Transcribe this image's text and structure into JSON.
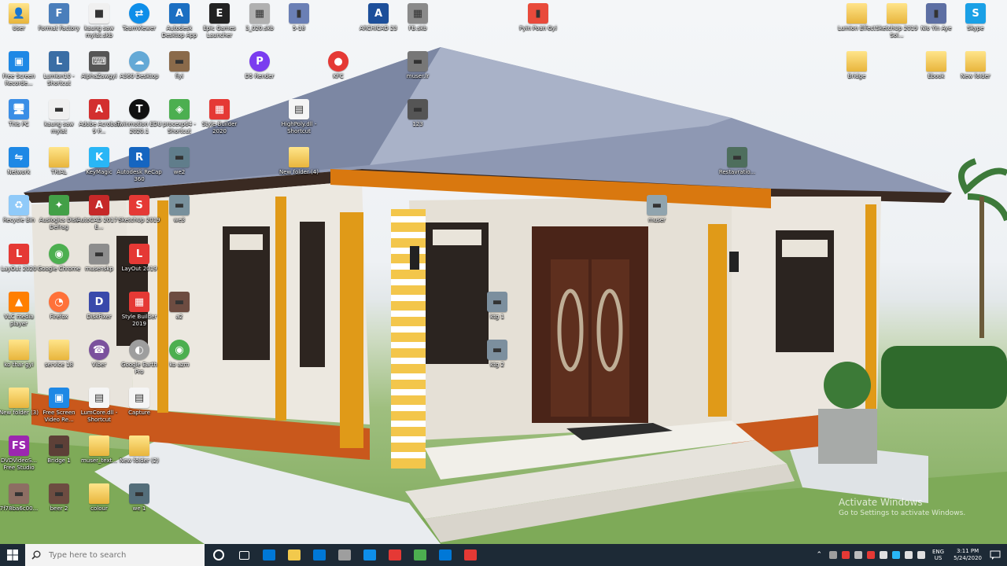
{
  "desktop": {
    "icons": [
      {
        "label": "User",
        "color": "#f2c94c",
        "kind": "folder",
        "glyph": "👤"
      },
      {
        "label": "Format Factory",
        "color": "#4a7ebb",
        "kind": "app",
        "glyph": "F"
      },
      {
        "label": "kaung saw mylat.skb",
        "color": "#f0f0f0",
        "kind": "file",
        "glyph": "■"
      },
      {
        "label": "TeamViewer",
        "color": "#0e8ee9",
        "kind": "round",
        "glyph": "⇄"
      },
      {
        "label": "Autodesk Desktop App",
        "color": "#1b6fc2",
        "kind": "app",
        "glyph": "A"
      },
      {
        "label": "Epic Games Launcher",
        "color": "#222222",
        "kind": "app",
        "glyph": "E"
      },
      {
        "label": "3_020.skb",
        "color": "#b0b0b0",
        "kind": "file",
        "glyph": "▦"
      },
      {
        "label": "5-18",
        "color": "#6a7fb5",
        "kind": "file",
        "glyph": "▮"
      },
      {
        "label": "ARCHICAD 23",
        "color": "#1d4f9a",
        "kind": "app",
        "glyph": "A"
      },
      {
        "label": "FB.skb",
        "color": "#8a8a8a",
        "kind": "file",
        "glyph": "▦"
      },
      {
        "label": "Pyin Poan Gyi",
        "color": "#e84a3b",
        "kind": "file",
        "glyph": "▮"
      },
      {
        "label": "Lumion Effect",
        "color": "#f2c94c",
        "kind": "folder",
        "glyph": ""
      },
      {
        "label": "SketchUp 2019 Sol...",
        "color": "#f2c94c",
        "kind": "folder",
        "glyph": ""
      },
      {
        "label": "Nio Yin Aye",
        "color": "#5d6fa3",
        "kind": "file",
        "glyph": "▮"
      },
      {
        "label": "Skype",
        "color": "#1aa0e6",
        "kind": "app",
        "glyph": "S"
      },
      {
        "label": "Free Screen Recorde...",
        "color": "#1e88e5",
        "kind": "app",
        "glyph": "▣"
      },
      {
        "label": "Lumion10 - Shortcut",
        "color": "#3a6ea5",
        "kind": "app",
        "glyph": "L"
      },
      {
        "label": "AlphaZawgyi",
        "color": "#555555",
        "kind": "app",
        "glyph": "⌨"
      },
      {
        "label": "A360 Desktop",
        "color": "#64a9d6",
        "kind": "round",
        "glyph": "☁"
      },
      {
        "label": "fiyi",
        "color": "#8a6a4a",
        "kind": "file",
        "glyph": "▬"
      },
      {
        "label": "D5 Render",
        "color": "#7a3cf0",
        "kind": "round",
        "glyph": "P"
      },
      {
        "label": "KFC",
        "color": "#e53935",
        "kind": "round",
        "glyph": "●"
      },
      {
        "label": "muser.lr",
        "color": "#777777",
        "kind": "file",
        "glyph": "▬"
      },
      {
        "label": "Bridge",
        "color": "#f2c94c",
        "kind": "folder",
        "glyph": ""
      },
      {
        "label": "Ebook",
        "color": "#f2c94c",
        "kind": "folder",
        "glyph": ""
      },
      {
        "label": "New folder",
        "color": "#f2c94c",
        "kind": "folder",
        "glyph": ""
      },
      {
        "label": "This PC",
        "color": "#3a8ee6",
        "kind": "app",
        "glyph": "🖥"
      },
      {
        "label": "kaung saw mylat",
        "color": "#f0f0f0",
        "kind": "file",
        "glyph": "▬"
      },
      {
        "label": "Adobe Acrobat 9 P...",
        "color": "#d32f2f",
        "kind": "app",
        "glyph": "A"
      },
      {
        "label": "Twinmotion EDU 2020.1",
        "color": "#111111",
        "kind": "round",
        "glyph": "T"
      },
      {
        "label": "procexp64 - Shortcut",
        "color": "#4caf50",
        "kind": "app",
        "glyph": "◈"
      },
      {
        "label": "Style Builder 2020",
        "color": "#e53935",
        "kind": "app",
        "glyph": "▦"
      },
      {
        "label": "HighPoly.dll - Shortcut",
        "color": "#f5f5f5",
        "kind": "file",
        "glyph": "▤"
      },
      {
        "label": "123",
        "color": "#555555",
        "kind": "file",
        "glyph": "▬"
      },
      {
        "label": "Network",
        "color": "#1e88e5",
        "kind": "app",
        "glyph": "⇋"
      },
      {
        "label": "TRIAL",
        "color": "#f2c94c",
        "kind": "folder",
        "glyph": ""
      },
      {
        "label": "KeyMagic",
        "color": "#29b6f6",
        "kind": "app",
        "glyph": "K"
      },
      {
        "label": "Autodesk ReCap 360",
        "color": "#1565c0",
        "kind": "app",
        "glyph": "R"
      },
      {
        "label": "we2",
        "color": "#607d8b",
        "kind": "file",
        "glyph": "▬"
      },
      {
        "label": "New folder (4)",
        "color": "#f2c94c",
        "kind": "folder",
        "glyph": ""
      },
      {
        "label": "Restavratio...",
        "color": "#4e6e5d",
        "kind": "file",
        "glyph": "▬"
      },
      {
        "label": "Recycle Bin",
        "color": "#90caf9",
        "kind": "app",
        "glyph": "♻"
      },
      {
        "label": "Auslogics Disk Defrag",
        "color": "#43a047",
        "kind": "app",
        "glyph": "✦"
      },
      {
        "label": "AutoCAD 2017 - E...",
        "color": "#c62828",
        "kind": "app",
        "glyph": "A"
      },
      {
        "label": "SketchUp 2019",
        "color": "#e53935",
        "kind": "app",
        "glyph": "S"
      },
      {
        "label": "we3",
        "color": "#78909c",
        "kind": "file",
        "glyph": "▬"
      },
      {
        "label": "muser",
        "color": "#90a4ae",
        "kind": "file",
        "glyph": "▬"
      },
      {
        "label": "LayOut 2020",
        "color": "#e53935",
        "kind": "app",
        "glyph": "L"
      },
      {
        "label": "Google Chrome",
        "color": "#4caf50",
        "kind": "round",
        "glyph": "◉"
      },
      {
        "label": "musenskp",
        "color": "#8d8d8d",
        "kind": "file",
        "glyph": "▬"
      },
      {
        "label": "LayOut 2019",
        "color": "#e53935",
        "kind": "app",
        "glyph": "L"
      },
      {
        "label": "VLC media player",
        "color": "#ff7f00",
        "kind": "app",
        "glyph": "▲"
      },
      {
        "label": "Firefox",
        "color": "#ff7139",
        "kind": "round",
        "glyph": "◔"
      },
      {
        "label": "DiskFixer",
        "color": "#3949ab",
        "kind": "app",
        "glyph": "D"
      },
      {
        "label": "Style Builder 2019",
        "color": "#e53935",
        "kind": "app",
        "glyph": "▦"
      },
      {
        "label": "a2",
        "color": "#6d4c41",
        "kind": "file",
        "glyph": "▬"
      },
      {
        "label": "ktg 1",
        "color": "#7c8f9e",
        "kind": "file",
        "glyph": "▬"
      },
      {
        "label": "ko thar gyi",
        "color": "#f2c94c",
        "kind": "folder",
        "glyph": ""
      },
      {
        "label": "service 18",
        "color": "#f2c94c",
        "kind": "folder",
        "glyph": ""
      },
      {
        "label": "Viber",
        "color": "#7b519d",
        "kind": "round",
        "glyph": "☎"
      },
      {
        "label": "Google Earth Pro",
        "color": "#9e9e9e",
        "kind": "round",
        "glyph": "◐"
      },
      {
        "label": "ko azm",
        "color": "#4caf50",
        "kind": "round",
        "glyph": "◉"
      },
      {
        "label": "ktg 2",
        "color": "#7c8f9e",
        "kind": "file",
        "glyph": "▬"
      },
      {
        "label": "New folder (3)",
        "color": "#f2c94c",
        "kind": "folder",
        "glyph": ""
      },
      {
        "label": "Free Screen Video Re...",
        "color": "#1e88e5",
        "kind": "app",
        "glyph": "▣"
      },
      {
        "label": "LumCore.dll - Shortcut",
        "color": "#f5f5f5",
        "kind": "file",
        "glyph": "▤"
      },
      {
        "label": "Capture",
        "color": "#f5f5f5",
        "kind": "file",
        "glyph": "▤"
      },
      {
        "label": "DVDVideoS... Free Studio",
        "color": "#9c27b0",
        "kind": "app",
        "glyph": "FS"
      },
      {
        "label": "Bridge 1",
        "color": "#5d4037",
        "kind": "file",
        "glyph": "▬"
      },
      {
        "label": "muser_text...",
        "color": "#f2c94c",
        "kind": "folder",
        "glyph": ""
      },
      {
        "label": "New folder (2)",
        "color": "#f2c94c",
        "kind": "folder",
        "glyph": ""
      },
      {
        "label": "7f78ba6c00...",
        "color": "#8d6e63",
        "kind": "file",
        "glyph": "▬"
      },
      {
        "label": "beer 2",
        "color": "#6d4c41",
        "kind": "file",
        "glyph": "▬"
      },
      {
        "label": "colour",
        "color": "#f2c94c",
        "kind": "folder",
        "glyph": ""
      },
      {
        "label": "we 1",
        "color": "#546e7a",
        "kind": "file",
        "glyph": "▬"
      }
    ]
  },
  "watermark": {
    "title": "Activate Windows",
    "subtitle": "Go to Settings to activate Windows."
  },
  "taskbar": {
    "search_placeholder": "Type here to search",
    "pinned": [
      {
        "name": "cortana",
        "color": "#ffffff"
      },
      {
        "name": "task-view",
        "color": "#ffffff"
      },
      {
        "name": "store",
        "color": "#0078d7"
      },
      {
        "name": "file-explorer",
        "color": "#f2c94c"
      },
      {
        "name": "mail",
        "color": "#0078d7"
      },
      {
        "name": "app-gray",
        "color": "#9e9e9e"
      },
      {
        "name": "teamviewer",
        "color": "#0e8ee9"
      },
      {
        "name": "app-red",
        "color": "#e53935"
      },
      {
        "name": "chrome",
        "color": "#4caf50"
      },
      {
        "name": "photo-viewer",
        "color": "#0078d7"
      },
      {
        "name": "sketchup",
        "color": "#e53935"
      }
    ],
    "language_line1": "ENG",
    "language_line2": "US",
    "time": "3:11 PM",
    "date": "5/24/2020"
  }
}
